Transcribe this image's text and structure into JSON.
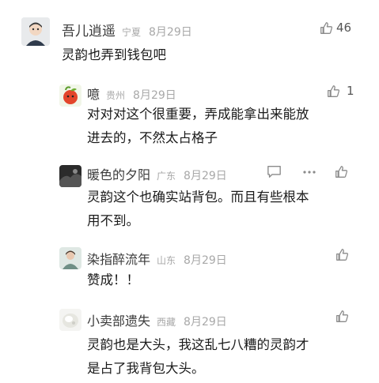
{
  "comments": [
    {
      "name": "吾儿逍遥",
      "location": "宁夏",
      "date": "8月29日",
      "likes": "46",
      "text": "灵韵也弄到钱包吧"
    },
    {
      "name": "噫",
      "location": "贵州",
      "date": "8月29日",
      "likes": "1",
      "lines": [
        "对对对这个很重要，弄成能拿出来能放",
        "进去的，不然太占格子"
      ]
    },
    {
      "name": "暖色的夕阳",
      "location": "广东",
      "date": "8月29日",
      "lines": [
        "灵韵这个也确实站背包。而且有些根本",
        "用不到。"
      ]
    },
    {
      "name": "染指醉流年",
      "location": "山东",
      "date": "8月29日",
      "text": "赞成！！"
    },
    {
      "name": "小卖部遗失",
      "location": "西藏",
      "date": "8月29日",
      "lines": [
        "灵韵也是大头，我这乱七八糟的灵韵才",
        "是占了我背包大头。"
      ]
    }
  ],
  "icons": {
    "like": "thumbs-up-icon",
    "reply": "speech-bubble-icon",
    "more": "more-dots-icon"
  },
  "colors": {
    "name": "#3b3b3b",
    "meta": "#a8a8a8",
    "text": "#1a1a1a",
    "icon": "#8a8a8a"
  }
}
